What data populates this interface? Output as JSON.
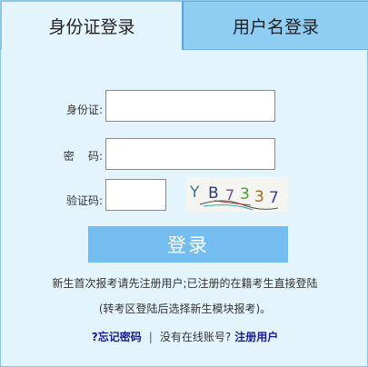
{
  "tabs": {
    "id_card_login": "身份证登录",
    "username_login": "用户名登录"
  },
  "form": {
    "id_label": "身份证:",
    "password_label": "密    码:",
    "captcha_label": "验证码:",
    "id_value": "",
    "password_value": "",
    "captcha_value": "",
    "captcha_text": "YB7337"
  },
  "login_button": "登录",
  "notes": {
    "line1": "新生首次报考请先注册用户;已注册的在籍考生直接登陆",
    "line2": "(转考区登陆后选择新生模块报考)。"
  },
  "links": {
    "forgot_password": "?忘记密码",
    "separator": "|",
    "no_account": "没有在线账号?",
    "register": "注册用户"
  },
  "colors": {
    "panel_bg": "#e4f4fd",
    "inactive_tab_bg": "#8fcdf2",
    "button_bg": "#73bdf0",
    "link_color": "#1a1aa0"
  }
}
